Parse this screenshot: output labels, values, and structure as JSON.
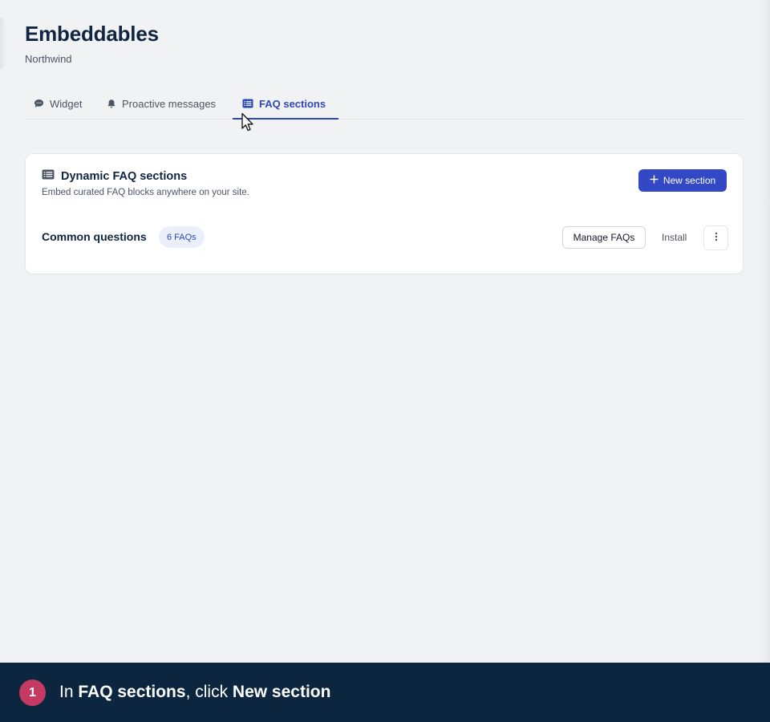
{
  "header": {
    "title": "Embeddables",
    "subtitle": "Northwind"
  },
  "tabs": [
    {
      "label": "Widget",
      "icon": "chat-bubble-icon",
      "active": false
    },
    {
      "label": "Proactive messages",
      "icon": "bell-icon",
      "active": false
    },
    {
      "label": "FAQ sections",
      "icon": "list-icon",
      "active": true
    }
  ],
  "card": {
    "icon": "list-icon",
    "title": "Dynamic FAQ sections",
    "description": "Embed curated FAQ blocks anywhere on your site.",
    "new_button_label": "New section",
    "new_button_icon": "plus-icon",
    "rows": [
      {
        "title": "Common questions",
        "badge": "6 FAQs",
        "manage_label": "Manage FAQs",
        "install_label": "Install",
        "more_icon": "more-vertical-icon"
      }
    ]
  },
  "caption": {
    "step": "1",
    "prefix": "In ",
    "target1": "FAQ sections",
    "middle": ", click ",
    "target2": "New section"
  },
  "colors": {
    "accent": "#3248c4",
    "title_text": "#0f2542",
    "caption_bg": "#0d2640",
    "step_badge": "#c43a63",
    "badge_bg": "#ebeffa",
    "page_bg": "#f1f2f4"
  }
}
